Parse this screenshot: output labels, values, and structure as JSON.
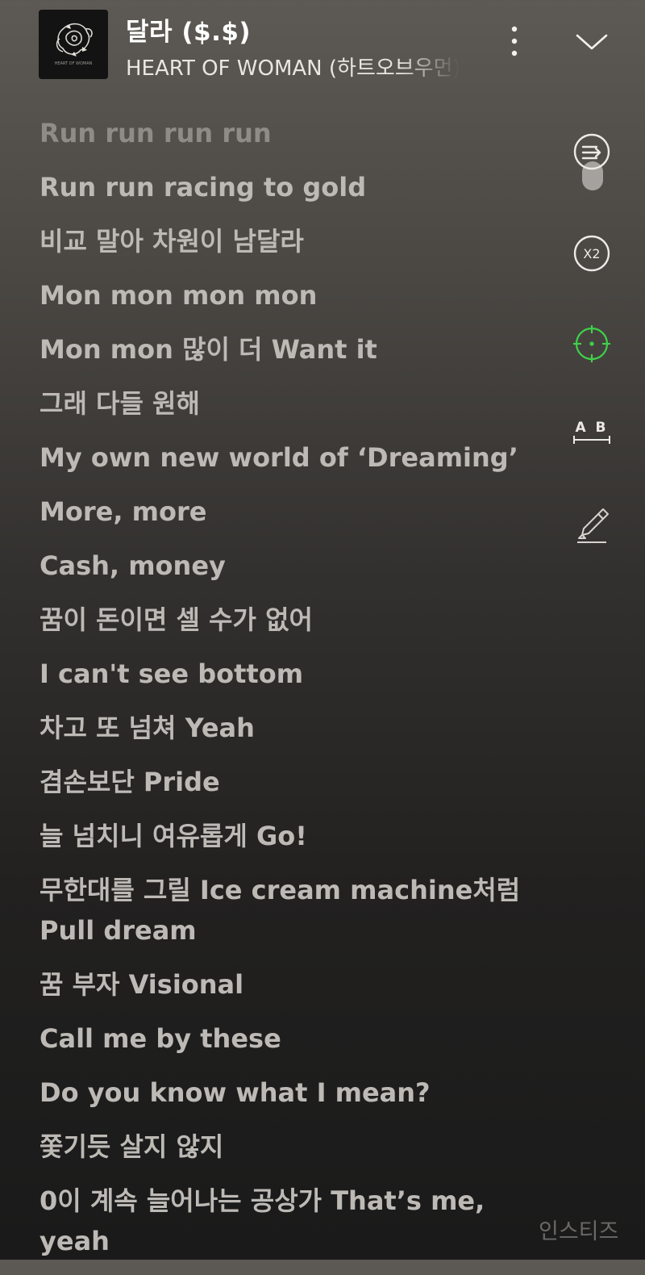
{
  "header": {
    "title": "달라 ($.$)",
    "artist": "HEART OF WOMAN (하트오브우먼)",
    "album_art_text": "HEART OF WOMAN"
  },
  "lyrics": [
    {
      "text": "Run run run run",
      "state": "past"
    },
    {
      "text": "Run run racing to gold",
      "state": "current"
    },
    {
      "text": "비교 말아 차원이 남달라",
      "state": "upcoming"
    },
    {
      "text": "Mon mon mon mon",
      "state": "upcoming"
    },
    {
      "text": "Mon mon 많이 더 Want it",
      "state": "upcoming"
    },
    {
      "text": "그래 다들 원해",
      "state": "upcoming"
    },
    {
      "text": "My own new world of ‘Dreaming’",
      "state": "upcoming"
    },
    {
      "text": "More, more",
      "state": "upcoming"
    },
    {
      "text": "Cash, money",
      "state": "upcoming"
    },
    {
      "text": "꿈이 돈이면 셀 수가 없어",
      "state": "upcoming"
    },
    {
      "text": "I can't see bottom",
      "state": "upcoming"
    },
    {
      "text": "차고 또 넘쳐 Yeah",
      "state": "upcoming"
    },
    {
      "text": "겸손보단 Pride",
      "state": "upcoming"
    },
    {
      "text": "늘 넘치니 여유롭게 Go!",
      "state": "upcoming"
    },
    {
      "text": "무한대를 그릴 Ice cream machine처럼 Pull dream",
      "state": "upcoming"
    },
    {
      "text": "꿈 부자 Visional",
      "state": "upcoming"
    },
    {
      "text": "Call me by these",
      "state": "upcoming"
    },
    {
      "text": "Do you know what I mean?",
      "state": "upcoming"
    },
    {
      "text": "쫓기듯 살지 않지",
      "state": "upcoming"
    },
    {
      "text": "0이 계속 늘어나는 공상가 That’s me, yeah",
      "state": "upcoming"
    }
  ],
  "side_controls": {
    "speed_label": "X2",
    "translate_label": "A B"
  },
  "icons": {
    "more": "vertical-dots-icon",
    "collapse": "chevron-down-icon",
    "queue": "queue-arrow-icon",
    "speed": "speed-x2-icon",
    "focus": "crosshair-icon",
    "translate": "ab-translate-icon",
    "highlight": "highlighter-pen-icon"
  },
  "colors": {
    "focus_accent": "#3fd14a",
    "lyric_text": "#bdbab6",
    "lyric_dim": "#8f8c88",
    "title": "#ffffff"
  },
  "watermark": "인스티즈"
}
